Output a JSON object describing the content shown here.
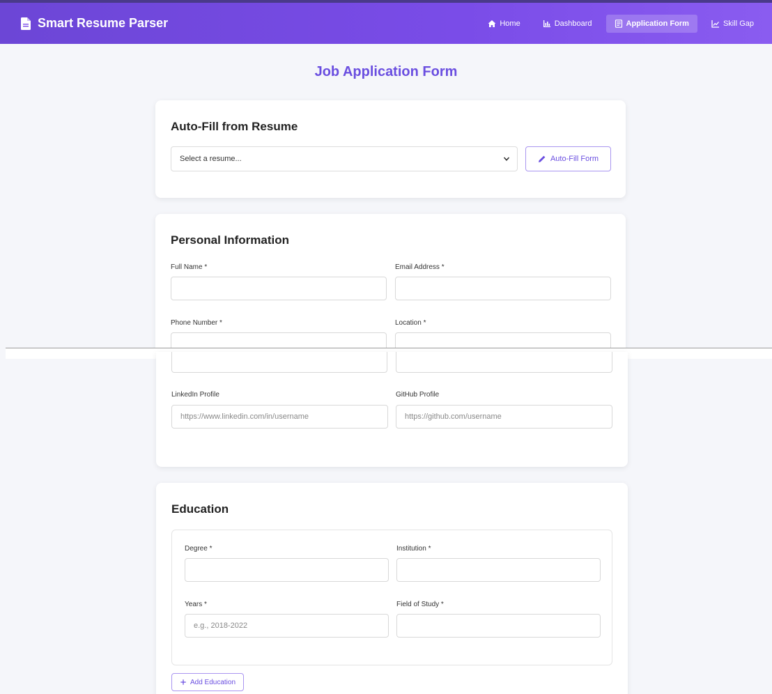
{
  "navbar": {
    "brand": "Smart Resume Parser",
    "brand_icon": "document-icon",
    "links": [
      {
        "label": "Home",
        "icon": "home-icon",
        "active": false
      },
      {
        "label": "Dashboard",
        "icon": "bar-chart-icon",
        "active": false
      },
      {
        "label": "Application Form",
        "icon": "form-icon",
        "active": true
      },
      {
        "label": "Skill Gap",
        "icon": "line-chart-icon",
        "active": false
      }
    ]
  },
  "page_title": "Job Application Form",
  "autofill": {
    "title": "Auto-Fill from Resume",
    "select_value": "Select a resume...",
    "button_label": "Auto-Fill Form"
  },
  "personal": {
    "title": "Personal Information",
    "full_name_label": "Full Name *",
    "email_label": "Email Address *",
    "phone_label": "Phone Number *",
    "location_label": "Location *",
    "linkedin_label": "LinkedIn Profile",
    "linkedin_placeholder": "https://www.linkedin.com/in/username",
    "github_label": "GitHub Profile",
    "github_placeholder": "https://github.com/username"
  },
  "education": {
    "title": "Education",
    "degree_label": "Degree *",
    "institution_label": "Institution *",
    "years_label": "Years *",
    "years_placeholder": "e.g., 2018-2022",
    "field_label": "Field of Study *",
    "add_button": "Add Education"
  },
  "colors": {
    "accent": "#6a4ee0",
    "navbar_start": "#6c46d6",
    "navbar_end": "#8a5cf0"
  }
}
